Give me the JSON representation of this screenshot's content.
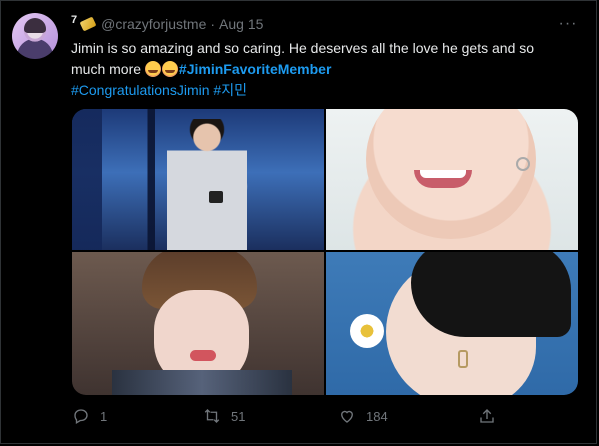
{
  "tweet": {
    "reply_badge": "7",
    "handle": "@crazyforjustme",
    "separator": "·",
    "date": "Aug 15",
    "text_line1": "Jimin is so amazing and so caring. He deserves all the love he gets and so",
    "text_line2_prefix": "much more",
    "hashtag1": "#JiminFavoriteMember",
    "hashtag2": "#CongratulationsJimin",
    "hashtag3": "#지민",
    "more_label": "···"
  },
  "actions": {
    "reply_count": "1",
    "retweet_count": "51",
    "like_count": "184"
  },
  "colors": {
    "background": "#000000",
    "text": "#e7e9ea",
    "muted": "#71767b",
    "link": "#1d9bf0",
    "border": "#2f3336"
  },
  "icons": [
    "avatar",
    "more-icon",
    "reply-icon",
    "retweet-icon",
    "like-icon",
    "share-icon"
  ]
}
